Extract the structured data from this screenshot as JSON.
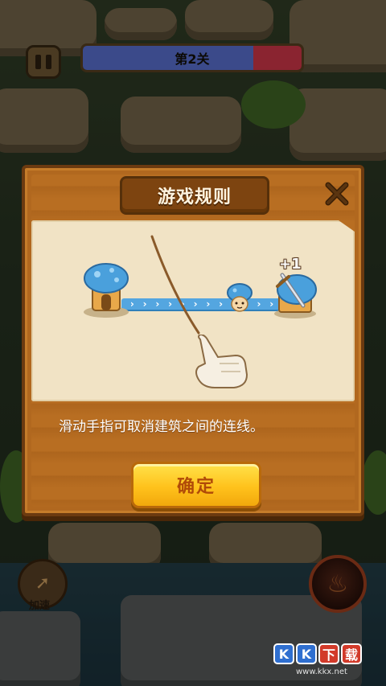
{
  "hud": {
    "level_label": "第2关",
    "level_progress": 0.78,
    "speed_label": "加速"
  },
  "modal": {
    "title": "游戏规则",
    "bonus": "+1",
    "description": "滑动手指可取消建筑之间的连线。",
    "confirm_label": "确定"
  },
  "watermark": {
    "chars": [
      "K",
      "K",
      "下",
      "载"
    ],
    "url": "www.kkx.net"
  },
  "colors": {
    "ally_blue": "#54a6e0",
    "enemy_red": "#8a2430",
    "button_yellow": "#ffc21c",
    "panel_wood": "#b1681f"
  }
}
